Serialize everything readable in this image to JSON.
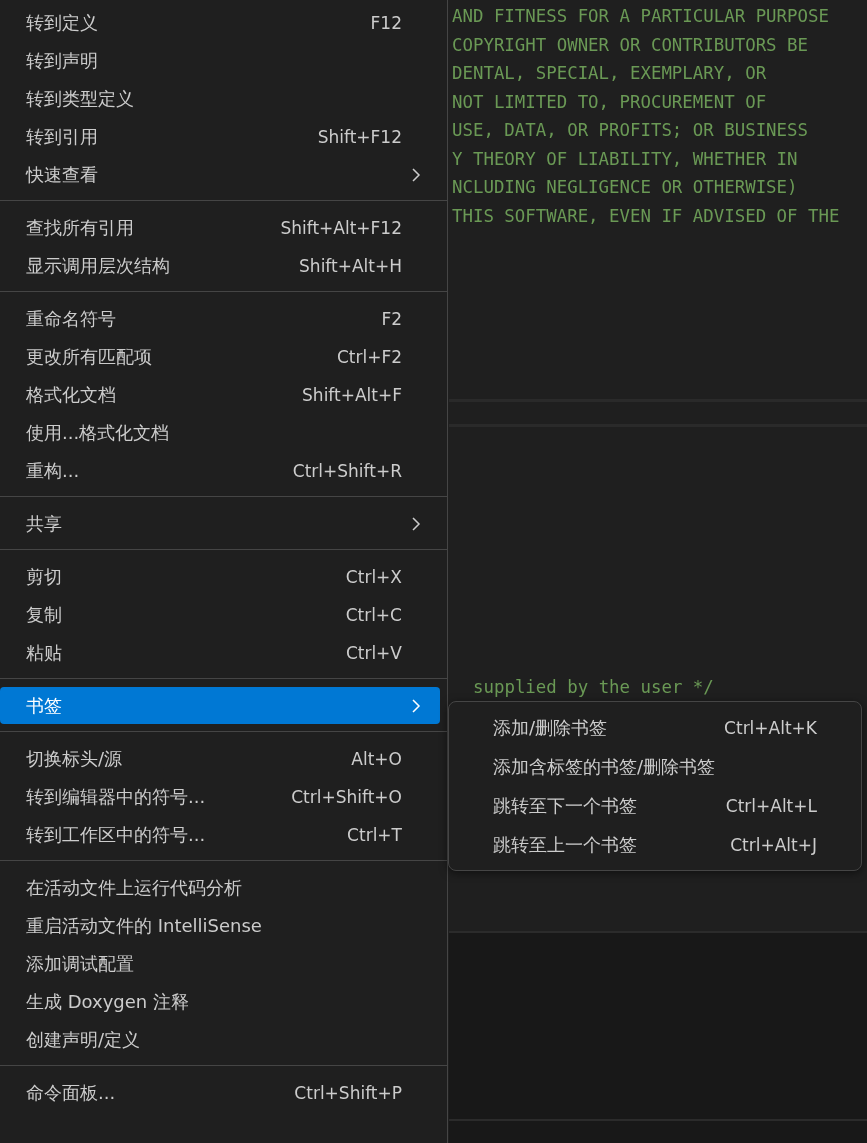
{
  "editor": {
    "code_lines": [
      "AND FITNESS FOR A PARTICULAR PURPOSE",
      "COPYRIGHT OWNER OR CONTRIBUTORS BE",
      "DENTAL, SPECIAL, EXEMPLARY, OR",
      "NOT LIMITED TO, PROCUREMENT OF",
      "USE, DATA, OR PROFITS; OR BUSINESS",
      "Y THEORY OF LIABILITY, WHETHER IN",
      "NCLUDING NEGLIGENCE OR OTHERWISE)",
      "THIS SOFTWARE, EVEN IF ADVISED OF THE"
    ],
    "lower_line": "supplied by the user */"
  },
  "context_menu": {
    "groups": [
      [
        {
          "label": "转到定义",
          "shortcut": "F12",
          "has_submenu": false,
          "selected": false
        },
        {
          "label": "转到声明",
          "has_submenu": false,
          "selected": false
        },
        {
          "label": "转到类型定义",
          "has_submenu": false,
          "selected": false
        },
        {
          "label": "转到引用",
          "shortcut": "Shift+F12",
          "has_submenu": false,
          "selected": false
        },
        {
          "label": "快速查看",
          "has_submenu": true,
          "selected": false
        }
      ],
      [
        {
          "label": "查找所有引用",
          "shortcut": "Shift+Alt+F12",
          "has_submenu": false,
          "selected": false
        },
        {
          "label": "显示调用层次结构",
          "shortcut": "Shift+Alt+H",
          "has_submenu": false,
          "selected": false
        }
      ],
      [
        {
          "label": "重命名符号",
          "shortcut": "F2",
          "has_submenu": false,
          "selected": false
        },
        {
          "label": "更改所有匹配项",
          "shortcut": "Ctrl+F2",
          "has_submenu": false,
          "selected": false
        },
        {
          "label": "格式化文档",
          "shortcut": "Shift+Alt+F",
          "has_submenu": false,
          "selected": false
        },
        {
          "label": "使用...格式化文档",
          "has_submenu": false,
          "selected": false
        },
        {
          "label": "重构...",
          "shortcut": "Ctrl+Shift+R",
          "has_submenu": false,
          "selected": false
        }
      ],
      [
        {
          "label": "共享",
          "has_submenu": true,
          "selected": false
        }
      ],
      [
        {
          "label": "剪切",
          "shortcut": "Ctrl+X",
          "has_submenu": false,
          "selected": false
        },
        {
          "label": "复制",
          "shortcut": "Ctrl+C",
          "has_submenu": false,
          "selected": false
        },
        {
          "label": "粘贴",
          "shortcut": "Ctrl+V",
          "has_submenu": false,
          "selected": false
        }
      ],
      [
        {
          "label": "书签",
          "has_submenu": true,
          "selected": true
        }
      ],
      [
        {
          "label": "切换标头/源",
          "shortcut": "Alt+O",
          "has_submenu": false,
          "selected": false
        },
        {
          "label": "转到编辑器中的符号...",
          "shortcut": "Ctrl+Shift+O",
          "has_submenu": false,
          "selected": false
        },
        {
          "label": "转到工作区中的符号...",
          "shortcut": "Ctrl+T",
          "has_submenu": false,
          "selected": false
        }
      ],
      [
        {
          "label": "在活动文件上运行代码分析",
          "has_submenu": false,
          "selected": false
        },
        {
          "label": "重启活动文件的 IntelliSense",
          "has_submenu": false,
          "selected": false
        },
        {
          "label": "添加调试配置",
          "has_submenu": false,
          "selected": false
        },
        {
          "label": "生成 Doxygen 注释",
          "has_submenu": false,
          "selected": false
        },
        {
          "label": "创建声明/定义",
          "has_submenu": false,
          "selected": false
        }
      ],
      [
        {
          "label": "命令面板...",
          "shortcut": "Ctrl+Shift+P",
          "has_submenu": false,
          "selected": false
        }
      ]
    ]
  },
  "submenu": {
    "items": [
      {
        "label": "添加/删除书签",
        "shortcut": "Ctrl+Alt+K"
      },
      {
        "label": "添加含标签的书签/删除书签"
      },
      {
        "label": "跳转至下一个书签",
        "shortcut": "Ctrl+Alt+L"
      },
      {
        "label": "跳转至上一个书签",
        "shortcut": "Ctrl+Alt+J"
      }
    ]
  }
}
